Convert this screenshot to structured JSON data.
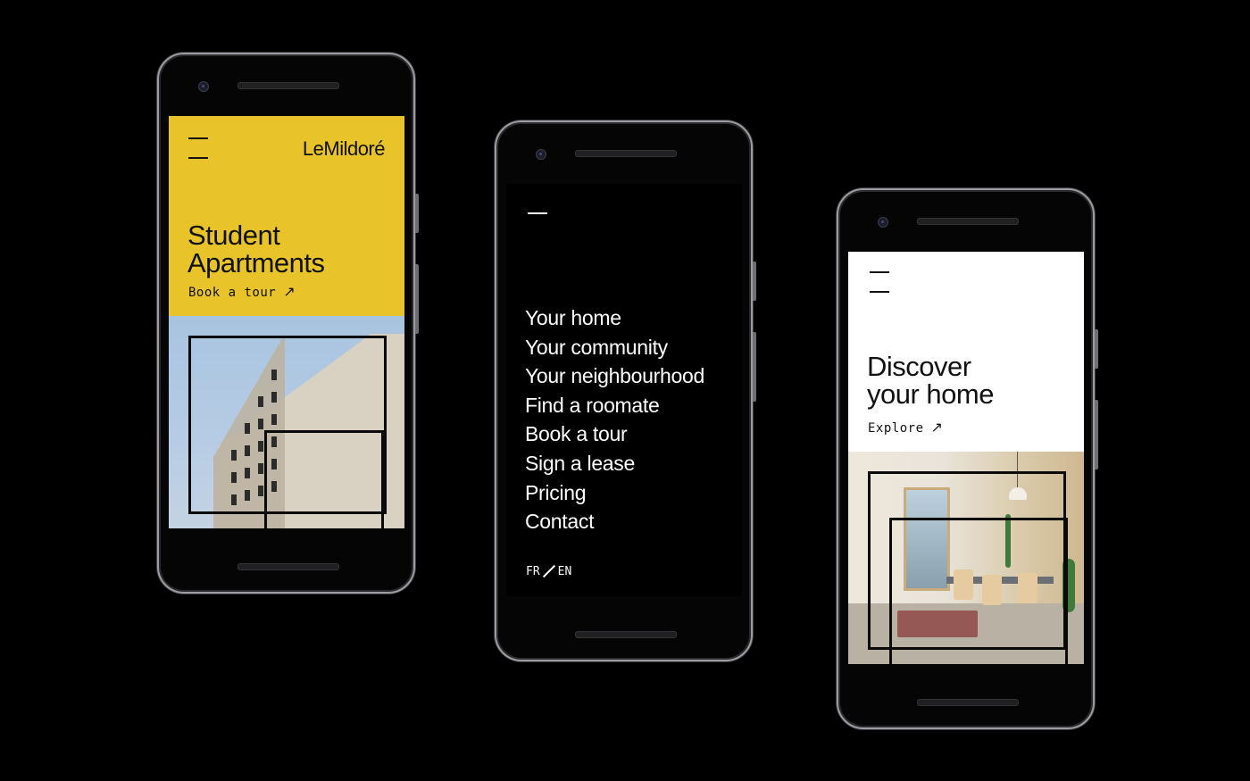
{
  "phone1": {
    "brand": "LeMildoré",
    "headline_line1": "Student",
    "headline_line2": "Apartments",
    "cta_label": "Book a tour",
    "cta_arrow": "↗",
    "accent_color": "#e8c42a"
  },
  "phone2": {
    "nav_items": [
      "Your home",
      "Your community",
      "Your neighbourhood",
      "Find a roomate",
      "Book a tour",
      "Sign a lease",
      "Pricing",
      "Contact"
    ],
    "lang_fr": "FR",
    "lang_en": "EN"
  },
  "phone3": {
    "headline_line1": "Discover",
    "headline_line2": "your home",
    "cta_label": "Explore",
    "cta_arrow": "↗"
  }
}
